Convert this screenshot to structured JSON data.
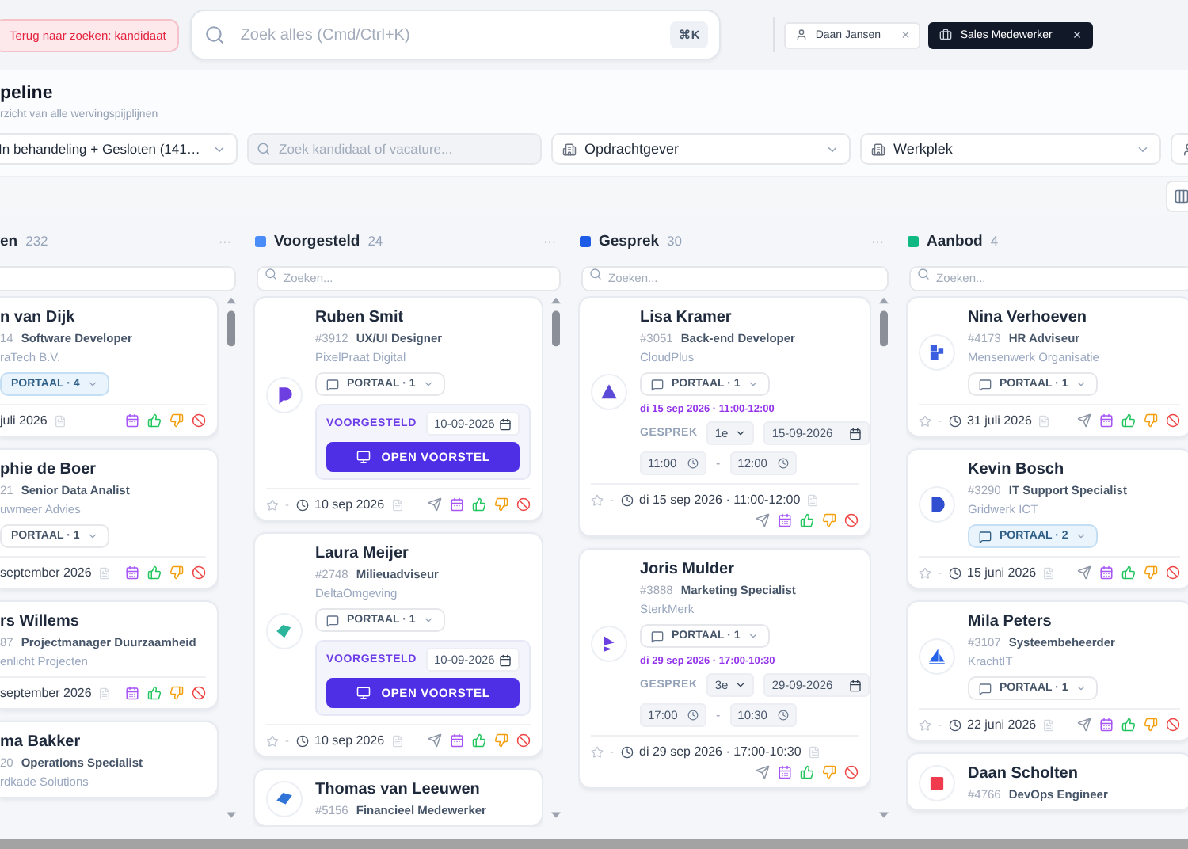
{
  "topbar": {
    "back_link": "Terug naar zoeken: kandidaat",
    "search": {
      "placeholder": "Zoek alles (Cmd/Ctrl+K)",
      "shortcut": "⌘K"
    },
    "chips": [
      {
        "kind": "person",
        "label": "Daan Jansen",
        "close": "×",
        "selected": false
      },
      {
        "kind": "role",
        "label": "Sales Medewerker",
        "close": "×",
        "selected": true
      }
    ]
  },
  "header": {
    "title": "peline",
    "subtitle": "rzicht van alle wervingspijplijnen"
  },
  "filters": [
    {
      "kind": "status",
      "value": "In behandeling + Gesloten (141…"
    },
    {
      "kind": "search",
      "placeholder": "Zoek kandidaat of vacature..."
    },
    {
      "kind": "client",
      "value": "Opdrachtgever"
    },
    {
      "kind": "workplace",
      "value": "Werkplek"
    },
    {
      "kind": "person"
    }
  ],
  "columns": [
    {
      "title": "en",
      "count": "232",
      "menu": "···",
      "clipped": true,
      "send": false,
      "cards": [
        {
          "name": "n van Dijk",
          "number": "14",
          "role": "Software Developer",
          "company": "raTech B.V.",
          "portaal": {
            "label": "PORTAAL · 4",
            "highlighted": true
          },
          "footer": {
            "date": "juli 2026"
          }
        },
        {
          "name": "phie de Boer",
          "number": "21",
          "role": "Senior Data Analist",
          "company": "uwmeer Advies",
          "portaal": {
            "label": "PORTAAL · 1",
            "highlighted": false
          },
          "footer": {
            "date": "september 2026"
          }
        },
        {
          "name": "rs Willems",
          "number": "87",
          "role": "Projectmanager Duurzaamheid",
          "company": "enlicht Projecten",
          "footer": {
            "date": "september 2026"
          }
        },
        {
          "name": "ma Bakker",
          "number": "20",
          "role": "Operations Specialist",
          "company": "rdkade Solutions"
        }
      ]
    },
    {
      "title": "Voorgesteld",
      "count": "24",
      "menu": "···",
      "color": "#4b8df8",
      "clipped": false,
      "send": true,
      "search_placeholder": "Zoeken...",
      "cards": [
        {
          "name": "Ruben Smit",
          "number": "#3912",
          "role": "UX/UI Designer",
          "company": "PixelPraat Digital",
          "logo": {
            "color": "#6d3fe0"
          },
          "portaal": {
            "label": "PORTAAL · 1",
            "highlighted": false
          },
          "stage": {
            "kind": "voorgesteld",
            "label": "VOORGESTELD",
            "date": "10-09-2026",
            "button": "OPEN VOORSTEL"
          },
          "footer": {
            "rating": "-",
            "date": "10 sep 2026"
          }
        },
        {
          "name": "Laura Meijer",
          "number": "#2748",
          "role": "Milieuadviseur",
          "company": "DeltaOmgeving",
          "logo": {
            "color": "#2bb59a"
          },
          "portaal": {
            "label": "PORTAAL · 1",
            "highlighted": false
          },
          "stage": {
            "kind": "voorgesteld",
            "label": "VOORGESTELD",
            "date": "10-09-2026",
            "button": "OPEN VOORSTEL"
          },
          "footer": {
            "rating": "-",
            "date": "10 sep 2026"
          }
        },
        {
          "name": "Thomas van Leeuwen",
          "number": "#5156",
          "role": "Financieel Medewerker",
          "logo": {
            "color": "#2f74d6"
          }
        }
      ]
    },
    {
      "title": "Gesprek",
      "count": "30",
      "menu": "···",
      "color": "#1d5ce6",
      "clipped": false,
      "send": true,
      "search_placeholder": "Zoeken...",
      "cards": [
        {
          "name": "Lisa Kramer",
          "number": "#3051",
          "role": "Back-end Developer",
          "company": "CloudPlus",
          "logo": {
            "color": "#5b4ad8"
          },
          "portaal": {
            "label": "PORTAAL · 1",
            "highlighted": false
          },
          "stage": {
            "kind": "gesprek",
            "summary": "di 15 sep 2026 · 11:00-12:00",
            "label": "GESPREK",
            "round": "1e",
            "date": "15-09-2026",
            "start": "11:00",
            "to": "-",
            "end": "12:00"
          },
          "footer": {
            "rating": "-",
            "date": "di 15 sep 2026 · 11:00-12:00"
          }
        },
        {
          "name": "Joris Mulder",
          "number": "#3888",
          "role": "Marketing Specialist",
          "company": "SterkMerk",
          "logo": {
            "color": "#6b3fe0"
          },
          "portaal": {
            "label": "PORTAAL · 1",
            "highlighted": false
          },
          "stage": {
            "kind": "gesprek",
            "summary": "di 29 sep 2026 · 17:00-10:30",
            "label": "GESPREK",
            "round": "3e",
            "date": "29-09-2026",
            "start": "17:00",
            "to": "-",
            "end": "10:30"
          },
          "footer": {
            "rating": "-",
            "date": "di 29 sep 2026 · 17:00-10:30"
          }
        }
      ]
    },
    {
      "title": "Aanbod",
      "count": "4",
      "color": "#10b981",
      "clipped": false,
      "send": true,
      "search_placeholder": "Zoeken...",
      "cards": [
        {
          "name": "Nina Verhoeven",
          "number": "#4173",
          "role": "HR Adviseur",
          "company": "Mensenwerk Organisatie",
          "logo": {
            "color": "#3b5fe0"
          },
          "portaal": {
            "label": "PORTAAL · 1",
            "highlighted": false
          },
          "footer": {
            "rating": "-",
            "date": "31 juli 2026"
          }
        },
        {
          "name": "Kevin Bosch",
          "number": "#3290",
          "role": "IT Support Specialist",
          "company": "Gridwerk ICT",
          "logo": {
            "color": "#2f4fd0"
          },
          "portaal": {
            "label": "PORTAAL · 2",
            "highlighted": true
          },
          "footer": {
            "rating": "-",
            "date": "15 juni 2026"
          }
        },
        {
          "name": "Mila Peters",
          "number": "#3107",
          "role": "Systeembeheerder",
          "company": "KrachtIT",
          "logo": {
            "color": "#2563eb"
          },
          "portaal": {
            "label": "PORTAAL · 1",
            "highlighted": false
          },
          "footer": {
            "rating": "-",
            "date": "22 juni 2026"
          }
        },
        {
          "name": "Daan Scholten",
          "number": "#4766",
          "role": "DevOps Engineer",
          "logo": {
            "color": "#ef3b4d"
          }
        }
      ]
    }
  ]
}
